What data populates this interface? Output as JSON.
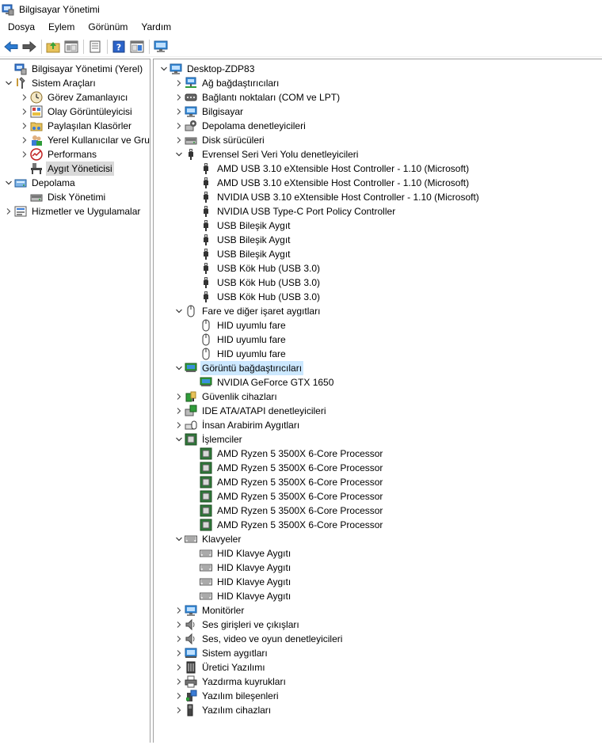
{
  "window": {
    "title": "Bilgisayar Yönetimi"
  },
  "menu": [
    "Dosya",
    "Eylem",
    "Görünüm",
    "Yardım"
  ],
  "toolbar": [
    "back-icon",
    "forward-icon",
    "up-folder-icon",
    "show-hide-tree-icon",
    "properties-icon",
    "help-icon",
    "action-pane-icon",
    "monitor-icon"
  ],
  "left_tree": [
    {
      "label": "Bilgisayar Yönetimi (Yerel)",
      "depth": 0,
      "chev": "",
      "icon": "computer-mgmt-icon"
    },
    {
      "label": "Sistem Araçları",
      "depth": 0,
      "chev": "down",
      "icon": "tools-icon"
    },
    {
      "label": "Görev Zamanlayıcı",
      "depth": 1,
      "chev": "right",
      "icon": "clock-icon"
    },
    {
      "label": "Olay Görüntüleyicisi",
      "depth": 1,
      "chev": "right",
      "icon": "event-viewer-icon"
    },
    {
      "label": "Paylaşılan Klasörler",
      "depth": 1,
      "chev": "right",
      "icon": "shared-folder-icon"
    },
    {
      "label": "Yerel Kullanıcılar ve Gru",
      "depth": 1,
      "chev": "right",
      "icon": "users-icon"
    },
    {
      "label": "Performans",
      "depth": 1,
      "chev": "right",
      "icon": "performance-icon"
    },
    {
      "label": "Aygıt Yöneticisi",
      "depth": 1,
      "chev": "",
      "icon": "device-manager-icon",
      "selected": true
    },
    {
      "label": "Depolama",
      "depth": 0,
      "chev": "down",
      "icon": "storage-icon"
    },
    {
      "label": "Disk Yönetimi",
      "depth": 1,
      "chev": "",
      "icon": "disk-icon"
    },
    {
      "label": "Hizmetler ve Uygulamalar",
      "depth": 0,
      "chev": "right",
      "icon": "services-icon"
    }
  ],
  "device_tree": [
    {
      "label": "Desktop-ZDP83",
      "depth": 0,
      "chev": "down",
      "icon": "computer-icon"
    },
    {
      "label": "Ağ bağdaştırıcıları",
      "depth": 1,
      "chev": "right",
      "icon": "network-icon"
    },
    {
      "label": "Bağlantı noktaları (COM ve LPT)",
      "depth": 1,
      "chev": "right",
      "icon": "port-icon"
    },
    {
      "label": "Bilgisayar",
      "depth": 1,
      "chev": "right",
      "icon": "monitor-icon"
    },
    {
      "label": "Depolama denetleyicileri",
      "depth": 1,
      "chev": "right",
      "icon": "storage-controller-icon"
    },
    {
      "label": "Disk sürücüleri",
      "depth": 1,
      "chev": "right",
      "icon": "disk-icon"
    },
    {
      "label": "Evrensel Seri Veri Yolu denetleyicileri",
      "depth": 1,
      "chev": "down",
      "icon": "usb-icon"
    },
    {
      "label": "AMD USB 3.10 eXtensible Host Controller - 1.10 (Microsoft)",
      "depth": 2,
      "chev": "",
      "icon": "usb-icon"
    },
    {
      "label": "AMD USB 3.10 eXtensible Host Controller - 1.10 (Microsoft)",
      "depth": 2,
      "chev": "",
      "icon": "usb-icon"
    },
    {
      "label": "NVIDIA USB 3.10 eXtensible Host Controller - 1.10 (Microsoft)",
      "depth": 2,
      "chev": "",
      "icon": "usb-icon"
    },
    {
      "label": "NVIDIA USB Type-C Port Policy Controller",
      "depth": 2,
      "chev": "",
      "icon": "usb-icon"
    },
    {
      "label": "USB Bileşik Aygıt",
      "depth": 2,
      "chev": "",
      "icon": "usb-icon"
    },
    {
      "label": "USB Bileşik Aygıt",
      "depth": 2,
      "chev": "",
      "icon": "usb-icon"
    },
    {
      "label": "USB Bileşik Aygıt",
      "depth": 2,
      "chev": "",
      "icon": "usb-icon"
    },
    {
      "label": "USB Kök Hub (USB 3.0)",
      "depth": 2,
      "chev": "",
      "icon": "usb-icon"
    },
    {
      "label": "USB Kök Hub (USB 3.0)",
      "depth": 2,
      "chev": "",
      "icon": "usb-icon"
    },
    {
      "label": "USB Kök Hub (USB 3.0)",
      "depth": 2,
      "chev": "",
      "icon": "usb-icon"
    },
    {
      "label": "Fare ve diğer işaret aygıtları",
      "depth": 1,
      "chev": "down",
      "icon": "mouse-icon"
    },
    {
      "label": "HID uyumlu fare",
      "depth": 2,
      "chev": "",
      "icon": "mouse-icon"
    },
    {
      "label": "HID uyumlu fare",
      "depth": 2,
      "chev": "",
      "icon": "mouse-icon"
    },
    {
      "label": "HID uyumlu fare",
      "depth": 2,
      "chev": "",
      "icon": "mouse-icon"
    },
    {
      "label": "Görüntü bağdaştırıcıları",
      "depth": 1,
      "chev": "down",
      "icon": "display-adapter-icon",
      "selected": true
    },
    {
      "label": "NVIDIA GeForce GTX 1650",
      "depth": 2,
      "chev": "",
      "icon": "display-adapter-icon"
    },
    {
      "label": "Güvenlik cihazları",
      "depth": 1,
      "chev": "right",
      "icon": "security-device-icon"
    },
    {
      "label": "IDE ATA/ATAPI denetleyicileri",
      "depth": 1,
      "chev": "right",
      "icon": "ide-icon"
    },
    {
      "label": "İnsan Arabirim Aygıtları",
      "depth": 1,
      "chev": "right",
      "icon": "hid-icon"
    },
    {
      "label": "İşlemciler",
      "depth": 1,
      "chev": "down",
      "icon": "processor-icon"
    },
    {
      "label": "AMD Ryzen 5 3500X 6-Core Processor",
      "depth": 2,
      "chev": "",
      "icon": "processor-icon"
    },
    {
      "label": "AMD Ryzen 5 3500X 6-Core Processor",
      "depth": 2,
      "chev": "",
      "icon": "processor-icon"
    },
    {
      "label": "AMD Ryzen 5 3500X 6-Core Processor",
      "depth": 2,
      "chev": "",
      "icon": "processor-icon"
    },
    {
      "label": "AMD Ryzen 5 3500X 6-Core Processor",
      "depth": 2,
      "chev": "",
      "icon": "processor-icon"
    },
    {
      "label": "AMD Ryzen 5 3500X 6-Core Processor",
      "depth": 2,
      "chev": "",
      "icon": "processor-icon"
    },
    {
      "label": "AMD Ryzen 5 3500X 6-Core Processor",
      "depth": 2,
      "chev": "",
      "icon": "processor-icon"
    },
    {
      "label": "Klavyeler",
      "depth": 1,
      "chev": "down",
      "icon": "keyboard-icon"
    },
    {
      "label": "HID Klavye Aygıtı",
      "depth": 2,
      "chev": "",
      "icon": "keyboard-icon"
    },
    {
      "label": "HID Klavye Aygıtı",
      "depth": 2,
      "chev": "",
      "icon": "keyboard-icon"
    },
    {
      "label": "HID Klavye Aygıtı",
      "depth": 2,
      "chev": "",
      "icon": "keyboard-icon"
    },
    {
      "label": "HID Klavye Aygıtı",
      "depth": 2,
      "chev": "",
      "icon": "keyboard-icon"
    },
    {
      "label": "Monitörler",
      "depth": 1,
      "chev": "right",
      "icon": "monitor-icon"
    },
    {
      "label": "Ses girişleri ve çıkışları",
      "depth": 1,
      "chev": "right",
      "icon": "speaker-icon"
    },
    {
      "label": "Ses, video ve oyun denetleyicileri",
      "depth": 1,
      "chev": "right",
      "icon": "speaker-icon"
    },
    {
      "label": "Sistem aygıtları",
      "depth": 1,
      "chev": "right",
      "icon": "system-device-icon"
    },
    {
      "label": "Üretici Yazılımı",
      "depth": 1,
      "chev": "right",
      "icon": "firmware-icon"
    },
    {
      "label": "Yazdırma kuyrukları",
      "depth": 1,
      "chev": "right",
      "icon": "printer-icon"
    },
    {
      "label": "Yazılım bileşenleri",
      "depth": 1,
      "chev": "right",
      "icon": "software-component-icon"
    },
    {
      "label": "Yazılım cihazları",
      "depth": 1,
      "chev": "right",
      "icon": "software-device-icon"
    }
  ],
  "colors": {
    "selected_blue": "#cce8ff",
    "selected_grey": "#d9d9d9",
    "icon_blue": "#1e73be"
  }
}
